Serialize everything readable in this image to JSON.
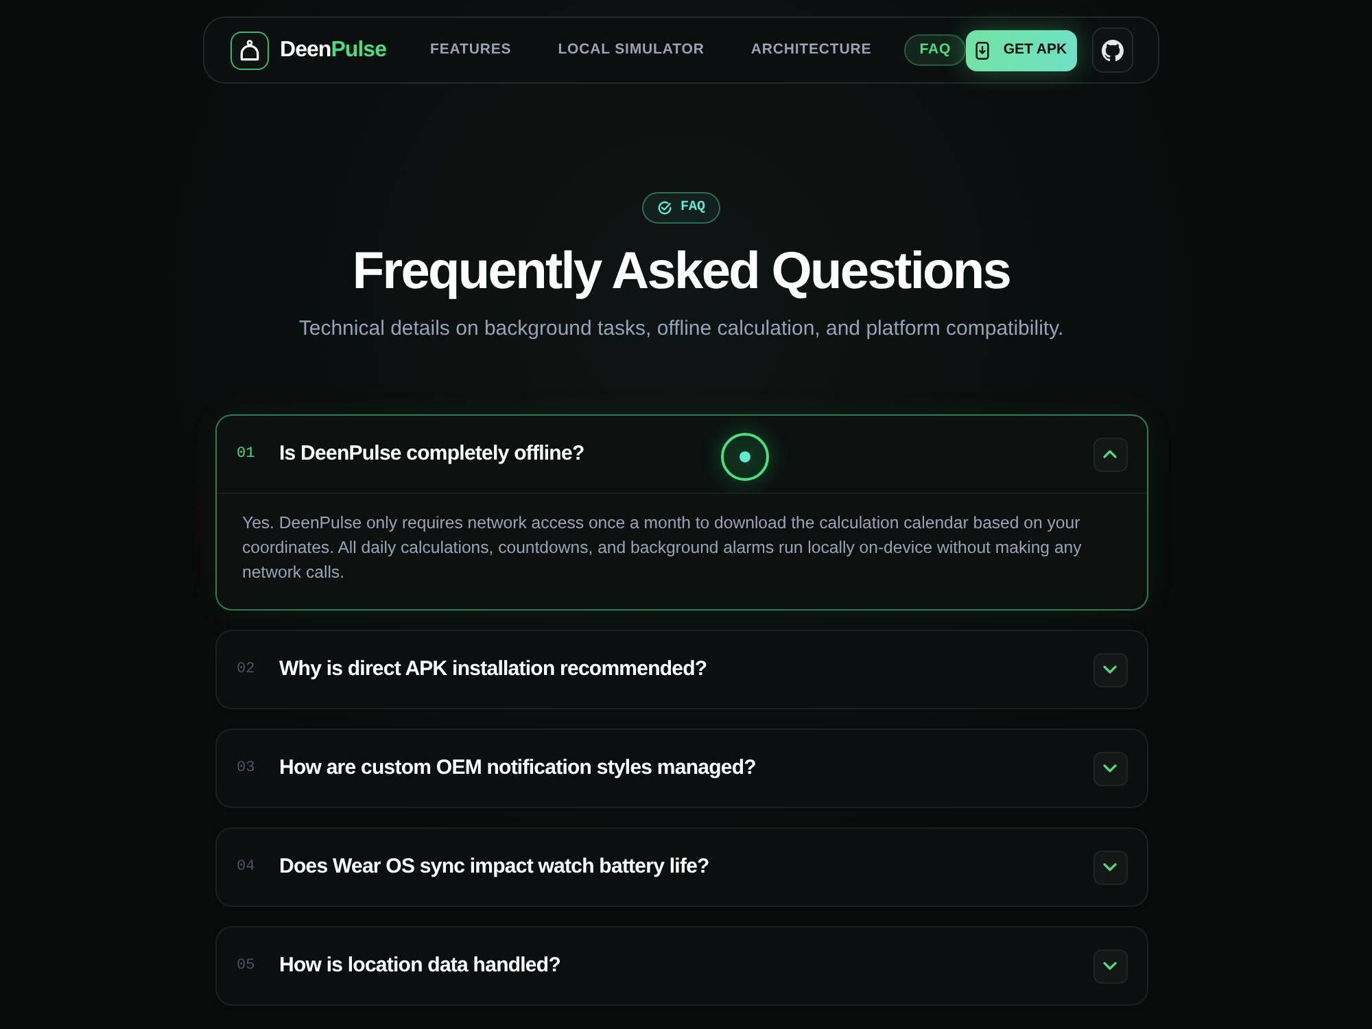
{
  "nav": {
    "brand": {
      "name": "Deen",
      "accent": "Pulse"
    },
    "links": [
      {
        "label": "FEATURES",
        "selected": false
      },
      {
        "label": "LOCAL SIMULATOR",
        "selected": false
      },
      {
        "label": "ARCHITECTURE",
        "selected": false
      },
      {
        "label": "FAQ",
        "selected": true
      }
    ],
    "cta": {
      "label": "GET APK"
    }
  },
  "header": {
    "badge": "FAQ",
    "title": "Frequently Asked Questions",
    "subtitle": "Technical details on background tasks, offline calculation, and platform compatibility."
  },
  "faqs": [
    {
      "number": "01",
      "question": "Is DeenPulse completely offline?",
      "expanded": true,
      "answer": "Yes. DeenPulse only requires network access once a month to download the calculation calendar based on your coordinates. All daily calculations, countdowns, and background alarms run locally on-device without making any network calls."
    },
    {
      "number": "02",
      "question": "Why is direct APK installation recommended?",
      "expanded": false
    },
    {
      "number": "03",
      "question": "How are custom OEM notification styles managed?",
      "expanded": false
    },
    {
      "number": "04",
      "question": "Does Wear OS sync impact watch battery life?",
      "expanded": false
    },
    {
      "number": "05",
      "question": "How is location data handled?",
      "expanded": false
    }
  ]
}
